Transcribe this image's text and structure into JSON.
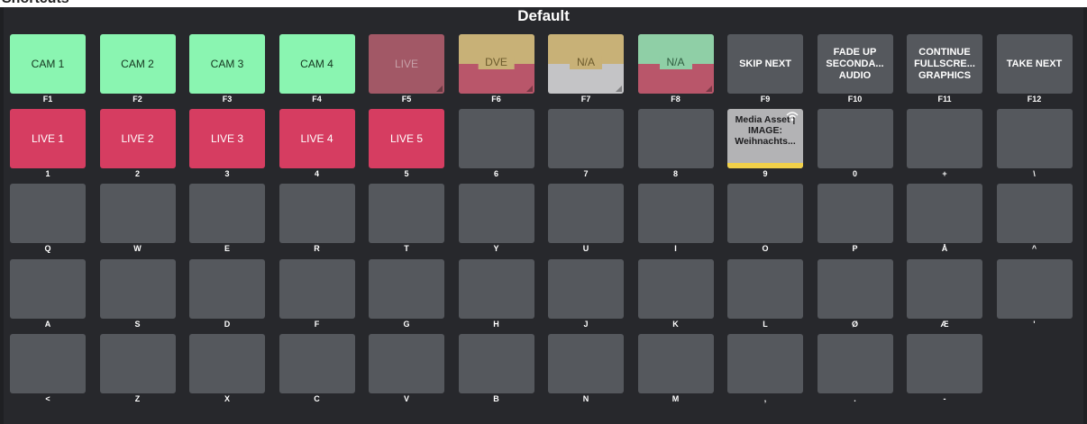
{
  "window": {
    "header_title": "Shortcuts"
  },
  "panel": {
    "title": "Default"
  },
  "keys": [
    {
      "key": "F1",
      "label": "CAM 1",
      "style": "green"
    },
    {
      "key": "F2",
      "label": "CAM 2",
      "style": "green"
    },
    {
      "key": "F3",
      "label": "CAM 3",
      "style": "green"
    },
    {
      "key": "F4",
      "label": "CAM 4",
      "style": "green"
    },
    {
      "key": "F5",
      "label": "LIVE",
      "style": "live-faded",
      "corner": true
    },
    {
      "key": "F6",
      "label": "DVE",
      "style": "split",
      "top": "#c8b177",
      "bottom": "#b9566a",
      "pill_bg": "#c8b177",
      "pill_color": "#6b5a2c",
      "corner": true
    },
    {
      "key": "F7",
      "label": "N/A",
      "style": "split",
      "top": "#c8b177",
      "bottom": "#c4c4c6",
      "pill_bg": "#c8b177",
      "pill_color": "#6b5a2c",
      "corner": true
    },
    {
      "key": "F8",
      "label": "N/A",
      "style": "split",
      "top": "#8fcfa6",
      "bottom": "#b9566a",
      "pill_bg": "#8fcfa6",
      "pill_color": "#2e5c3f",
      "corner": true
    },
    {
      "key": "F9",
      "label": "SKIP NEXT",
      "style": "dark"
    },
    {
      "key": "F10",
      "label": "FADE UP SECONDA... AUDIO",
      "style": "dark"
    },
    {
      "key": "F11",
      "label": "CONTINUE FULLSCRE... GRAPHICS",
      "style": "dark"
    },
    {
      "key": "F12",
      "label": "TAKE NEXT",
      "style": "dark"
    },
    {
      "key": "1",
      "label": "LIVE 1",
      "style": "red"
    },
    {
      "key": "2",
      "label": "LIVE 2",
      "style": "red"
    },
    {
      "key": "3",
      "label": "LIVE 3",
      "style": "red"
    },
    {
      "key": "4",
      "label": "LIVE 4",
      "style": "red"
    },
    {
      "key": "5",
      "label": "LIVE 5",
      "style": "red"
    },
    {
      "key": "6",
      "label": "",
      "style": "empty"
    },
    {
      "key": "7",
      "label": "",
      "style": "empty"
    },
    {
      "key": "8",
      "label": "",
      "style": "empty"
    },
    {
      "key": "9",
      "label": "Media Asset | IMAGE: Weihnachts...",
      "style": "media",
      "icon": "broadcast-icon"
    },
    {
      "key": "0",
      "label": "",
      "style": "empty"
    },
    {
      "key": "+",
      "label": "",
      "style": "empty"
    },
    {
      "key": "\\",
      "label": "",
      "style": "empty"
    },
    {
      "key": "Q",
      "label": "",
      "style": "empty"
    },
    {
      "key": "W",
      "label": "",
      "style": "empty"
    },
    {
      "key": "E",
      "label": "",
      "style": "empty"
    },
    {
      "key": "R",
      "label": "",
      "style": "empty"
    },
    {
      "key": "T",
      "label": "",
      "style": "empty"
    },
    {
      "key": "Y",
      "label": "",
      "style": "empty"
    },
    {
      "key": "U",
      "label": "",
      "style": "empty"
    },
    {
      "key": "I",
      "label": "",
      "style": "empty"
    },
    {
      "key": "O",
      "label": "",
      "style": "empty"
    },
    {
      "key": "P",
      "label": "",
      "style": "empty"
    },
    {
      "key": "Å",
      "label": "",
      "style": "empty"
    },
    {
      "key": "^",
      "label": "",
      "style": "empty"
    },
    {
      "key": "A",
      "label": "",
      "style": "empty"
    },
    {
      "key": "S",
      "label": "",
      "style": "empty"
    },
    {
      "key": "D",
      "label": "",
      "style": "empty"
    },
    {
      "key": "F",
      "label": "",
      "style": "empty"
    },
    {
      "key": "G",
      "label": "",
      "style": "empty"
    },
    {
      "key": "H",
      "label": "",
      "style": "empty"
    },
    {
      "key": "J",
      "label": "",
      "style": "empty"
    },
    {
      "key": "K",
      "label": "",
      "style": "empty"
    },
    {
      "key": "L",
      "label": "",
      "style": "empty"
    },
    {
      "key": "Ø",
      "label": "",
      "style": "empty"
    },
    {
      "key": "Æ",
      "label": "",
      "style": "empty"
    },
    {
      "key": "'",
      "label": "",
      "style": "empty"
    },
    {
      "key": "<",
      "label": "",
      "style": "empty"
    },
    {
      "key": "Z",
      "label": "",
      "style": "empty"
    },
    {
      "key": "X",
      "label": "",
      "style": "empty"
    },
    {
      "key": "C",
      "label": "",
      "style": "empty"
    },
    {
      "key": "V",
      "label": "",
      "style": "empty"
    },
    {
      "key": "B",
      "label": "",
      "style": "empty"
    },
    {
      "key": "N",
      "label": "",
      "style": "empty"
    },
    {
      "key": "M",
      "label": "",
      "style": "empty"
    },
    {
      "key": ",",
      "label": "",
      "style": "empty"
    },
    {
      "key": ".",
      "label": "",
      "style": "empty"
    },
    {
      "key": "-",
      "label": "",
      "style": "empty"
    }
  ]
}
